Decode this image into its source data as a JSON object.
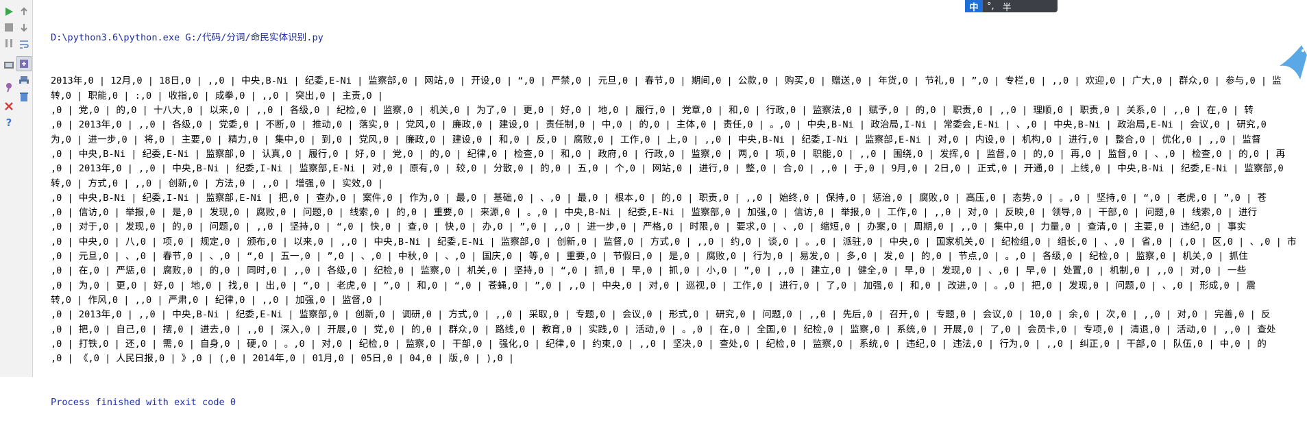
{
  "toolbar": {
    "icons": [
      "run-icon",
      "scroll-up-icon",
      "stop-icon",
      "scroll-down-icon",
      "pause-icon",
      "soft-wrap-icon",
      "print-icon",
      "pin-tab-icon",
      "settings-icon",
      "trash-icon",
      "close-icon",
      "help-icon"
    ]
  },
  "ime": {
    "logo": "中",
    "punct": "°,",
    "width_mode": "半"
  },
  "console": {
    "command": "D:\\python3.6\\python.exe G:/代码/分词/命民实体识别.py",
    "lines": [
      "2013年,0 | 12月,0 | 18日,0 | ,,0 | 中央,B-Ni | 纪委,E-Ni | 监察部,0 | 网站,0 | 开设,0 | “,0 | 严禁,0 | 元旦,0 | 春节,0 | 期间,0 | 公款,0 | 购买,0 | 赠送,0 | 年货,0 | 节礼,0 | ”,0 | 专栏,0 | ,,0 | 欢迎,0 | 广大,0 | 群众,0 | 参与,0 | 监",
      "转,0 | 职能,0 | :,0 | 收指,0 | 成拳,0 | ,,0 | 突出,0 | 主责,0 |",
      ",0 | 党,0 | 的,0 | 十八大,0 | 以来,0 | ,,0 | 各级,0 | 纪检,0 | 监察,0 | 机关,0 | 为了,0 | 更,0 | 好,0 | 地,0 | 履行,0 | 党章,0 | 和,0 | 行政,0 | 监察法,0 | 赋予,0 | 的,0 | 职责,0 | ,,0 | 理顺,0 | 职责,0 | 关系,0 | ,,0 | 在,0 | 转",
      ",0 | 2013年,0 | ,,0 | 各级,0 | 党委,0 | 不断,0 | 推动,0 | 落实,0 | 党风,0 | 廉政,0 | 建设,0 | 责任制,0 | 中,0 | 的,0 | 主体,0 | 责任,0 | 。,0 | 中央,B-Ni | 政治局,I-Ni | 常委会,E-Ni | 、,0 | 中央,B-Ni | 政治局,E-Ni | 会议,0 | 研究,0",
      "为,0 | 进一步,0 | 将,0 | 主要,0 | 精力,0 | 集中,0 | 到,0 | 党风,0 | 廉政,0 | 建设,0 | 和,0 | 反,0 | 腐败,0 | 工作,0 | 上,0 | ,,0 | 中央,B-Ni | 纪委,I-Ni | 监察部,E-Ni | 对,0 | 内设,0 | 机构,0 | 进行,0 | 整合,0 | 优化,0 | ,,0 | 监督",
      ",0 | 中央,B-Ni | 纪委,E-Ni | 监察部,0 | 认真,0 | 履行,0 | 好,0 | 党,0 | 的,0 | 纪律,0 | 检查,0 | 和,0 | 政府,0 | 行政,0 | 监察,0 | 两,0 | 项,0 | 职能,0 | ,,0 | 围绕,0 | 发挥,0 | 监督,0 | 的,0 | 再,0 | 监督,0 | 、,0 | 检查,0 | 的,0 | 再",
      ",0 | 2013年,0 | ,,0 | 中央,B-Ni | 纪委,I-Ni | 监察部,E-Ni | 对,0 | 原有,0 | 较,0 | 分散,0 | 的,0 | 五,0 | 个,0 | 网站,0 | 进行,0 | 整,0 | 合,0 | ,,0 | 于,0 | 9月,0 | 2日,0 | 正式,0 | 开通,0 | 上线,0 | 中央,B-Ni | 纪委,E-Ni | 监察部,0",
      "转,0 | 方式,0 | ,,0 | 创新,0 | 方法,0 | ,,0 | 增强,0 | 实效,0 |",
      ",0 | 中央,B-Ni | 纪委,I-Ni | 监察部,E-Ni | 把,0 | 查办,0 | 案件,0 | 作为,0 | 最,0 | 基础,0 | 、,0 | 最,0 | 根本,0 | 的,0 | 职责,0 | ,,0 | 始终,0 | 保持,0 | 惩治,0 | 腐败,0 | 高压,0 | 态势,0 | 。,0 | 坚持,0 | “,0 | 老虎,0 | ”,0 | 苍",
      ",0 | 信访,0 | 举报,0 | 是,0 | 发现,0 | 腐败,0 | 问题,0 | 线索,0 | 的,0 | 重要,0 | 来源,0 | 。,0 | 中央,B-Ni | 纪委,E-Ni | 监察部,0 | 加强,0 | 信访,0 | 举报,0 | 工作,0 | ,,0 | 对,0 | 反映,0 | 领导,0 | 干部,0 | 问题,0 | 线索,0 | 进行",
      ",0 | 对于,0 | 发现,0 | 的,0 | 问题,0 | ,,0 | 坚持,0 | “,0 | 快,0 | 查,0 | 快,0 | 办,0 | ”,0 | ,,0 | 进一步,0 | 严格,0 | 时限,0 | 要求,0 | 、,0 | 缩短,0 | 办案,0 | 周期,0 | ,,0 | 集中,0 | 力量,0 | 查清,0 | 主要,0 | 违纪,0 | 事实",
      ",0 | 中央,0 | 八,0 | 项,0 | 规定,0 | 颁布,0 | 以来,0 | ,,0 | 中央,B-Ni | 纪委,E-Ni | 监察部,0 | 创新,0 | 监督,0 | 方式,0 | ,,0 | 约,0 | 谈,0 | 。,0 | 派驻,0 | 中央,0 | 国家机关,0 | 纪检组,0 | 组长,0 | 、,0 | 省,0 | (,0 | 区,0 | 、,0 | 市",
      ",0 | 元旦,0 | 、,0 | 春节,0 | 、,0 | “,0 | 五一,0 | ”,0 | 、,0 | 中秋,0 | 、,0 | 国庆,0 | 等,0 | 重要,0 | 节假日,0 | 是,0 | 腐败,0 | 行为,0 | 易发,0 | 多,0 | 发,0 | 的,0 | 节点,0 | 。,0 | 各级,0 | 纪检,0 | 监察,0 | 机关,0 | 抓住",
      ",0 | 在,0 | 严惩,0 | 腐败,0 | 的,0 | 同时,0 | ,,0 | 各级,0 | 纪检,0 | 监察,0 | 机关,0 | 坚持,0 | “,0 | 抓,0 | 早,0 | 抓,0 | 小,0 | ”,0 | ,,0 | 建立,0 | 健全,0 | 早,0 | 发现,0 | 、,0 | 早,0 | 处置,0 | 机制,0 | ,,0 | 对,0 | 一些",
      ",0 | 为,0 | 更,0 | 好,0 | 地,0 | 找,0 | 出,0 | “,0 | 老虎,0 | ”,0 | 和,0 | “,0 | 苍蝇,0 | ”,0 | ,,0 | 中央,0 | 对,0 | 巡视,0 | 工作,0 | 进行,0 | 了,0 | 加强,0 | 和,0 | 改进,0 | 。,0 | 把,0 | 发现,0 | 问题,0 | 、,0 | 形成,0 | 震",
      "转,0 | 作风,0 | ,,0 | 严肃,0 | 纪律,0 | ,,0 | 加强,0 | 监督,0 |",
      ",0 | 2013年,0 | ,,0 | 中央,B-Ni | 纪委,E-Ni | 监察部,0 | 创新,0 | 调研,0 | 方式,0 | ,,0 | 采取,0 | 专题,0 | 会议,0 | 形式,0 | 研究,0 | 问题,0 | ,,0 | 先后,0 | 召开,0 | 专题,0 | 会议,0 | 10,0 | 余,0 | 次,0 | ,,0 | 对,0 | 完善,0 | 反",
      ",0 | 把,0 | 自己,0 | 摆,0 | 进去,0 | ,,0 | 深入,0 | 开展,0 | 党,0 | 的,0 | 群众,0 | 路线,0 | 教育,0 | 实践,0 | 活动,0 | 。,0 | 在,0 | 全国,0 | 纪检,0 | 监察,0 | 系统,0 | 开展,0 | 了,0 | 会员卡,0 | 专项,0 | 清退,0 | 活动,0 | ,,0 | 查处",
      ",0 | 打铁,0 | 还,0 | 需,0 | 自身,0 | 硬,0 | 。,0 | 对,0 | 纪检,0 | 监察,0 | 干部,0 | 强化,0 | 纪律,0 | 约束,0 | ,,0 | 坚决,0 | 查处,0 | 纪检,0 | 监察,0 | 系统,0 | 违纪,0 | 违法,0 | 行为,0 | ,,0 | 纠正,0 | 干部,0 | 队伍,0 | 中,0 | 的",
      ",0 | 《,0 | 人民日报,0 | 》,0 | (,0 | 2014年,0 | 01月,0 | 05日,0 | 04,0 | 版,0 | ),0 |"
    ],
    "exit_message": "Process finished with exit code 0"
  }
}
